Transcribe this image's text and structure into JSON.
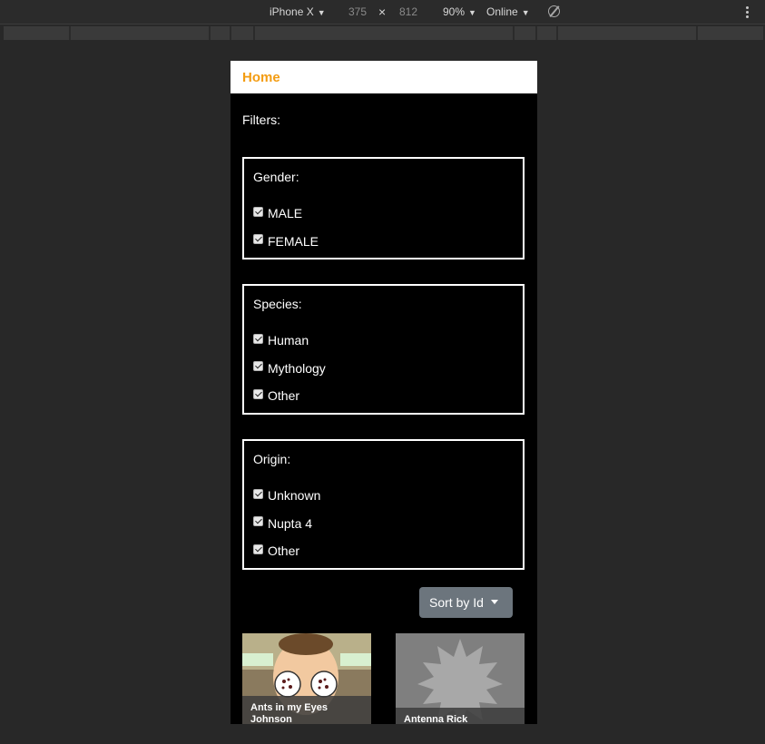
{
  "devtools": {
    "device": "iPhone X",
    "width": "375",
    "times": "×",
    "height": "812",
    "zoom": "90%",
    "network": "Online"
  },
  "navbar": {
    "brand": "Home"
  },
  "filters": {
    "title": "Filters:",
    "gender": {
      "legend": "Gender:",
      "options": [
        "MALE",
        "FEMALE"
      ]
    },
    "species": {
      "legend": "Species:",
      "options": [
        "Human",
        "Mythology",
        "Other"
      ]
    },
    "origin": {
      "legend": "Origin:",
      "options": [
        "Unknown",
        "Nupta 4",
        "Other"
      ]
    }
  },
  "sort": {
    "label": "Sort by Id"
  },
  "characters": [
    {
      "name": "Ants in my Eyes Johnson"
    },
    {
      "name": "Antenna Rick"
    }
  ],
  "colors": {
    "brand": "#f39c12",
    "sort_button": "#6c757d",
    "background": "#000000"
  }
}
